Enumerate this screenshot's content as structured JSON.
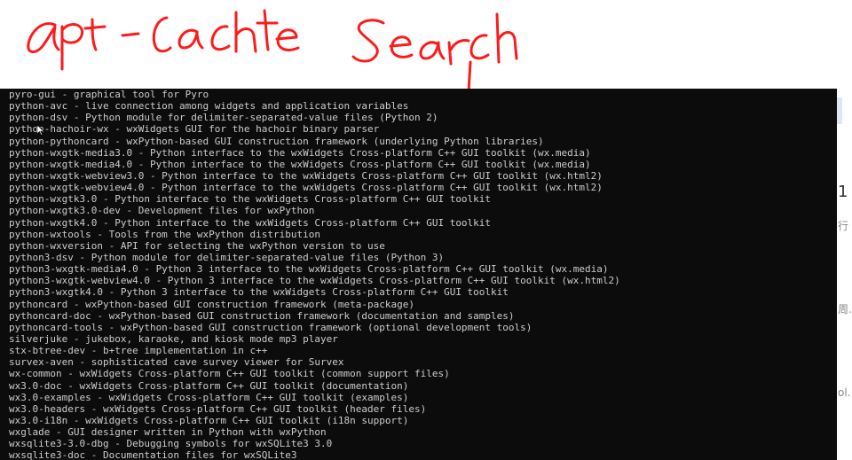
{
  "annotation": {
    "text": "apt-cache search",
    "color": "#ff1a1a"
  },
  "terminal": {
    "background": "#0c0c0c",
    "foreground": "#cccccc",
    "lines": [
      "pyro-gui - graphical tool for Pyro",
      "python-avc - live connection among widgets and application variables",
      "python-dsv - Python module for delimiter-separated-value files (Python 2)",
      "python-hachoir-wx - wxWidgets GUI for the hachoir binary parser",
      "python-pythoncard - wxPython-based GUI construction framework (underlying Python libraries)",
      "python-wxgtk-media3.0 - Python interface to the wxWidgets Cross-platform C++ GUI toolkit (wx.media)",
      "python-wxgtk-media4.0 - Python interface to the wxWidgets Cross-platform C++ GUI toolkit (wx.media)",
      "python-wxgtk-webview3.0 - Python interface to the wxWidgets Cross-platform C++ GUI toolkit (wx.html2)",
      "python-wxgtk-webview4.0 - Python interface to the wxWidgets Cross-platform C++ GUI toolkit (wx.html2)",
      "python-wxgtk3.0 - Python interface to the wxWidgets Cross-platform C++ GUI toolkit",
      "python-wxgtk3.0-dev - Development files for wxPython",
      "python-wxgtk4.0 - Python interface to the wxWidgets Cross-platform C++ GUI toolkit",
      "python-wxtools - Tools from the wxPython distribution",
      "python-wxversion - API for selecting the wxPython version to use",
      "python3-dsv - Python module for delimiter-separated-value files (Python 3)",
      "python3-wxgtk-media4.0 - Python 3 interface to the wxWidgets Cross-platform C++ GUI toolkit (wx.media)",
      "python3-wxgtk-webview4.0 - Python 3 interface to the wxWidgets Cross-platform C++ GUI toolkit (wx.html2)",
      "python3-wxgtk4.0 - Python 3 interface to the wxWidgets Cross-platform C++ GUI toolkit",
      "pythoncard - wxPython-based GUI construction framework (meta-package)",
      "pythoncard-doc - wxPython-based GUI construction framework (documentation and samples)",
      "pythoncard-tools - wxPython-based GUI construction framework (optional development tools)",
      "silverjuke - jukebox, karaoke, and kiosk mode mp3 player",
      "stx-btree-dev - b+tree implementation in c++",
      "survex-aven - sophisticated cave survey viewer for Survex",
      "wx-common - wxWidgets Cross-platform C++ GUI toolkit (common support files)",
      "wx3.0-doc - wxWidgets Cross-platform C++ GUI toolkit (documentation)",
      "wx3.0-examples - wxWidgets Cross-platform C++ GUI toolkit (examples)",
      "wx3.0-headers - wxWidgets Cross-platform C++ GUI toolkit (header files)",
      "wx3.0-i18n - wxWidgets Cross-platform C++ GUI toolkit (i18n support)",
      "wxglade - GUI designer written in Python with wxPython",
      "wxsqlite3-3.0-dbg - Debugging symbols for wxSQLite3 3.0",
      "wxsqlite3-doc - Documentation files for wxSQLite3"
    ]
  },
  "background_fragments": [
    "1",
    "行",
    "周.",
    "ol."
  ]
}
